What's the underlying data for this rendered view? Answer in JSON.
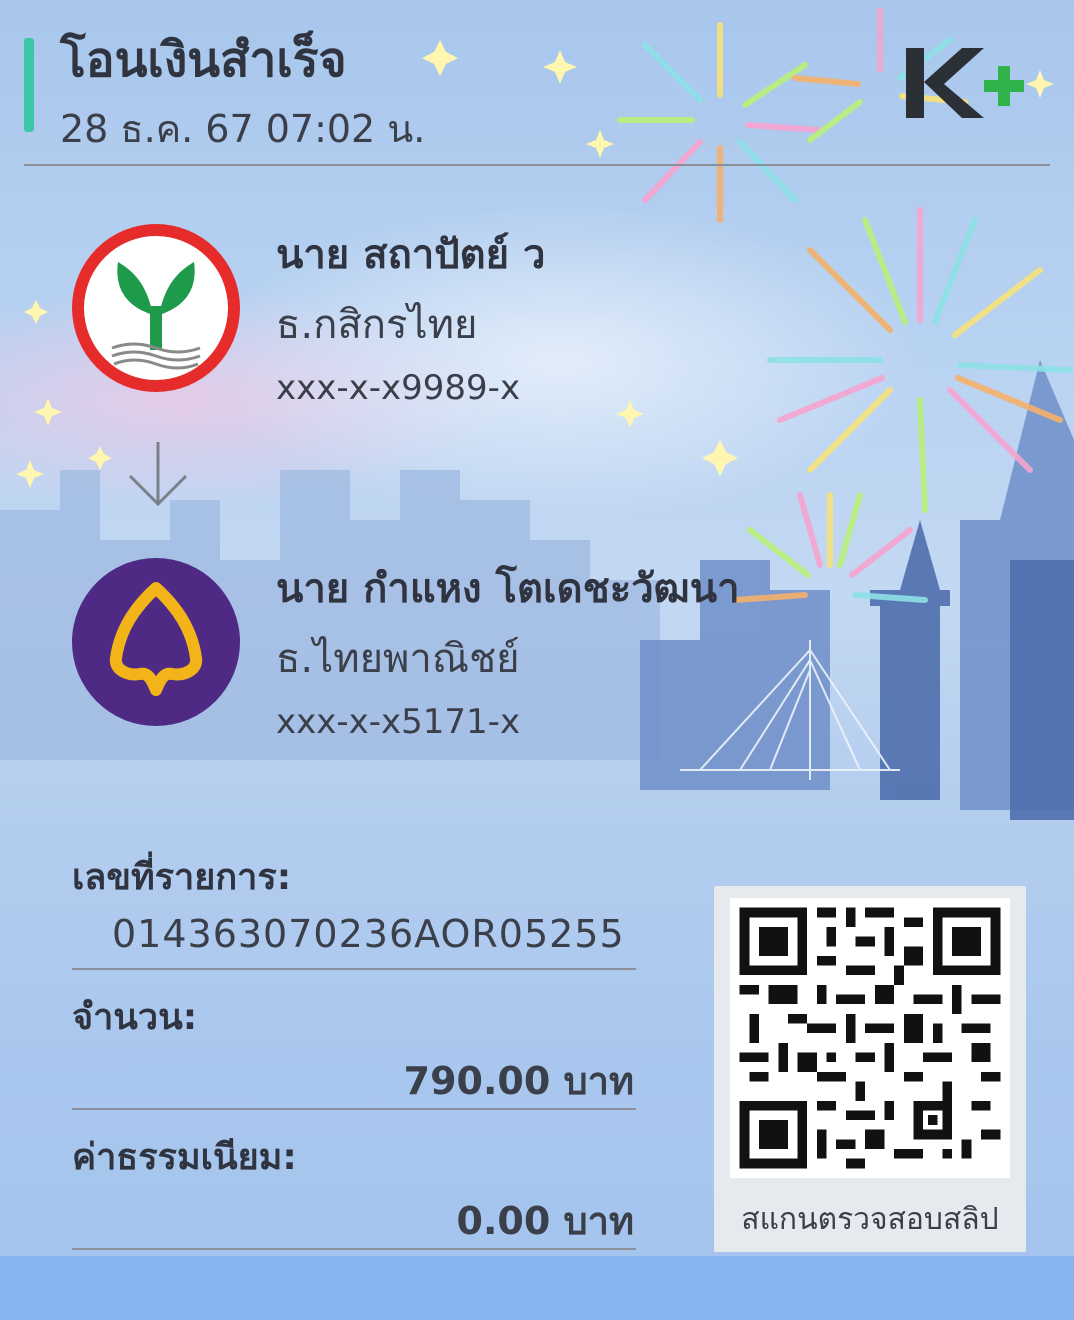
{
  "header": {
    "title": "โอนเงินสำเร็จ",
    "datetime": "28 ธ.ค. 67  07:02 น.",
    "logo": "K+"
  },
  "sender": {
    "name": "นาย สถาปัตย์ ว",
    "bank": "ธ.กสิกรไทย",
    "account": "xxx-x-x9989-x",
    "logo_icon": "kasikorn-bank-logo",
    "logo_color": "#e62b2b"
  },
  "receiver": {
    "name": "นาย กำแหง โตเดชะวัฒนา",
    "bank": "ธ.ไทยพาณิชย์",
    "account": "xxx-x-x5171-x",
    "logo_icon": "scb-bank-logo",
    "logo_color": "#4e2a84"
  },
  "transfer_arrow_icon": "arrow-down-icon",
  "details": {
    "reference_label": "เลขที่รายการ:",
    "reference_value": "014363070236AOR05255",
    "amount_label": "จำนวน:",
    "amount_value": "790.00 บาท",
    "fee_label": "ค่าธรรมเนียม:",
    "fee_value": "0.00 บาท"
  },
  "qr": {
    "caption": "สแกนตรวจสอบสลิป"
  },
  "colors": {
    "accent": "#3cc6a5",
    "kplus_green": "#2fb34a",
    "text": "#2f3440",
    "footer": "#87b4f0"
  }
}
